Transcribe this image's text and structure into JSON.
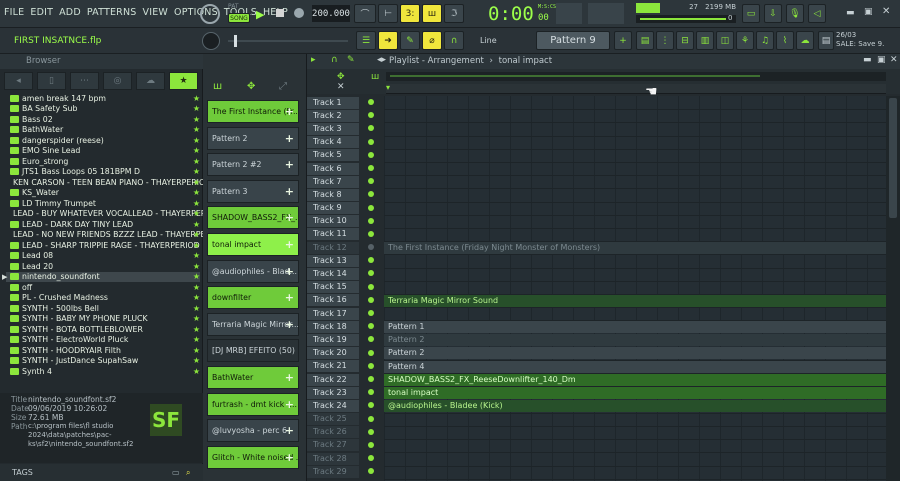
{
  "menu": [
    "FILE",
    "EDIT",
    "ADD",
    "PATTERNS",
    "VIEW",
    "OPTIONS",
    "TOOLS",
    "HELP"
  ],
  "transport": {
    "mode": "SONG",
    "mode_alt": "PAT",
    "tempo": "200.000",
    "time": "0:00",
    "time_sub": "00",
    "time_unit": "M:S:CS"
  },
  "monitor": {
    "cpu": "27",
    "ram": "2199 MB",
    "voices": "0"
  },
  "hint_text": "FIRST INSATNCE.flp",
  "snap_label": "Line",
  "pattern_select": "Pattern 9",
  "news": {
    "date": "26/03",
    "text": "SALE: Save 9."
  },
  "browser": {
    "title": "Browser",
    "items": [
      "amen break 147 bpm",
      "BA Safety Sub",
      "Bass 02",
      "BathWater",
      "dangerspider (reese)",
      "EMO Sine Lead",
      "Euro_strong",
      "JTS1 Bass Loops 05 181BPM D",
      "KEN CARSON - TEEN BEAN PIANO - THAYERPERIOD",
      "KS_Water",
      "LD Timmy Trumpet",
      "LEAD - BUY WHATEVER VOCALLEAD - THAYERPERIOD",
      "LEAD - DARK DAY TINY LEAD",
      "LEAD - NO NEW FRIENDS BZZZ LEAD - THAYERPERIOD",
      "LEAD - SHARP TRIPPIE RAGE - THAYERPERIOD",
      "Lead 08",
      "Lead 20",
      "nintendo_soundfont",
      "off",
      "PL - Crushed Madness",
      "SYNTH - 500lbs Bell",
      "SYNTH - BABY MY PHONE PLUCK",
      "SYNTH - BOTA BOTTLEBLOWER",
      "SYNTH - ElectroWorld Pluck",
      "SYNTH - HOODRYAIR Filth",
      "SYNTH - JustDance SupahSaw",
      "Synth 4"
    ],
    "selected": "nintendo_soundfont",
    "file_info": {
      "title_k": "Title",
      "title_v": "nintendo_soundfont.sf2",
      "date_k": "Date",
      "date_v": "09/06/2019 10:26:02",
      "size_k": "Size",
      "size_v": "72.61 MB",
      "path_k": "Path",
      "path_v1": "c:\\program files\\fl studio 2024\\data\\patches\\pac-",
      "path_v2": "ks\\sf2\\nintendo_soundfont.sf2"
    },
    "logo_text": "SF",
    "tags_label": "TAGS"
  },
  "picker": [
    {
      "label": "The First Instance (Fr...",
      "style": "green"
    },
    {
      "label": "Pattern 2",
      "style": "plain"
    },
    {
      "label": "Pattern 2 #2",
      "style": "plain"
    },
    {
      "label": "Pattern 3",
      "style": "plain"
    },
    {
      "label": "SHADOW_BASS2_FX_...",
      "style": "green"
    },
    {
      "label": "tonal impact",
      "style": "bright"
    },
    {
      "label": "@audiophiles - Blad...",
      "style": "plain"
    },
    {
      "label": "downfilter",
      "style": "green"
    },
    {
      "label": "Terraria Magic Mirror...",
      "style": "plain"
    },
    {
      "label": "[DJ MRB] EFEITO  (50)",
      "style": "dark"
    },
    {
      "label": "BathWater",
      "style": "green"
    },
    {
      "label": "furtrash - dmt kick -...",
      "style": "green"
    },
    {
      "label": "@luvyosha - perc 6",
      "style": "plain"
    },
    {
      "label": "Glitch - White noised ...",
      "style": "green"
    }
  ],
  "playlist": {
    "title": "Playlist - Arrangement",
    "sep": "›",
    "sub": "tonal impact",
    "tracks": [
      "Track 1",
      "Track 2",
      "Track 3",
      "Track 4",
      "Track 5",
      "Track 6",
      "Track 7",
      "Track 8",
      "Track 9",
      "Track 10",
      "Track 11",
      "Track 12",
      "Track 13",
      "Track 14",
      "Track 15",
      "Track 16",
      "Track 17",
      "Track 18",
      "Track 19",
      "Track 20",
      "Track 21",
      "Track 22",
      "Track 23",
      "Track 24",
      "Track 25",
      "Track 26",
      "Track 27",
      "Track 28",
      "Track 29"
    ],
    "clips": [
      {
        "track": 12,
        "label": "The First Instance (Friday Night Monster of Monsters)",
        "style": "muted"
      },
      {
        "track": 16,
        "label": "Terraria Magic Mirror Sound",
        "style": "audio"
      },
      {
        "track": 18,
        "label": "Pattern 1",
        "style": "pat"
      },
      {
        "track": 19,
        "label": "Pattern 2",
        "style": "muted"
      },
      {
        "track": 20,
        "label": "Pattern 2",
        "style": "pat"
      },
      {
        "track": 21,
        "label": "Pattern 4",
        "style": "pat"
      },
      {
        "track": 22,
        "label": "SHADOW_BASS2_FX_ReeseDownlifter_140_Dm",
        "style": "audio-b"
      },
      {
        "track": 23,
        "label": "tonal impact",
        "style": "audio-b"
      },
      {
        "track": 24,
        "label": "@audiophiles - Bladee (Kick)",
        "style": "audio"
      }
    ]
  }
}
